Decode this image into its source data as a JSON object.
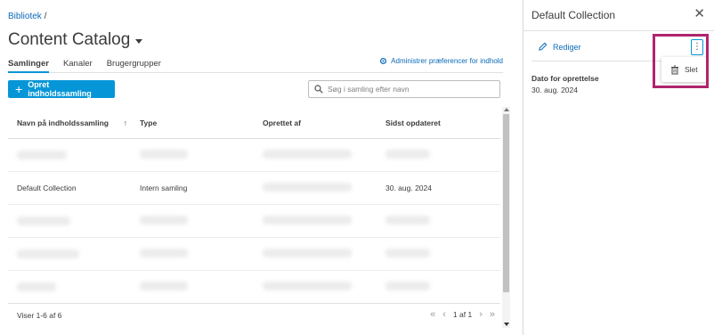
{
  "breadcrumb": {
    "link": "Bibliotek",
    "separator": "/"
  },
  "title": "Content Catalog",
  "tabs": [
    {
      "label": "Samlinger"
    },
    {
      "label": "Kanaler"
    },
    {
      "label": "Brugergrupper"
    }
  ],
  "prefs_link": "Administrer præferencer for indhold",
  "create_button": "Opret indholdssamling",
  "search": {
    "placeholder": "Søg i samling efter navn"
  },
  "table": {
    "headers": [
      "Navn på indholdssamling",
      "Type",
      "Oprettet af",
      "Sidst opdateret"
    ],
    "rows": [
      {
        "name": "",
        "type": "",
        "created_by": "",
        "updated": ""
      },
      {
        "name": "Default Collection",
        "type": "Intern samling",
        "created_by": "",
        "updated": "30. aug. 2024"
      },
      {
        "name": "",
        "type": "",
        "created_by": "",
        "updated": ""
      },
      {
        "name": "",
        "type": "",
        "created_by": "",
        "updated": ""
      },
      {
        "name": "",
        "type": "",
        "created_by": "",
        "updated": ""
      }
    ]
  },
  "footer": {
    "count": "Viser 1-6 af 6",
    "page": "1 af 1"
  },
  "panel": {
    "title": "Default Collection",
    "edit_label": "Rediger",
    "menu_delete": "Slet",
    "created_label": "Dato for oprettelse",
    "created_value": "30. aug. 2024"
  },
  "colors": {
    "accent": "#0696d7",
    "link": "#0b6bb8",
    "highlight": "#b0246f"
  }
}
